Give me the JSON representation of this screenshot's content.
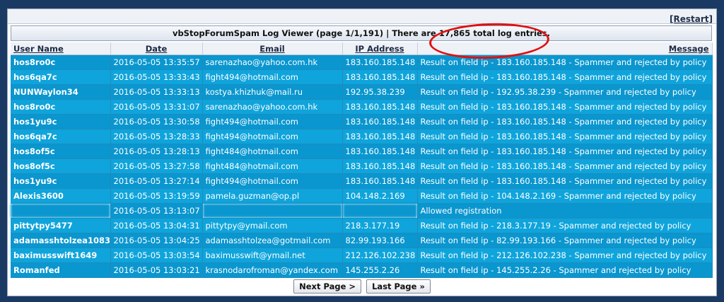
{
  "restart_label": "[Restart]",
  "title": "vbStopForumSpam Log Viewer (page 1/1,191) | There are 17,865 total log entries.",
  "annotation_color": "#e01010",
  "columns": {
    "user": "User Name",
    "date": "Date",
    "email": "Email",
    "ip": "IP Address",
    "message": "Message"
  },
  "rows": [
    {
      "user": "hos8ro0c",
      "date": "2016-05-05 13:35:57",
      "email": "sarenazhao@yahoo.com.hk",
      "ip": "183.160.185.148",
      "message": "Result on field ip - 183.160.185.148 - Spammer and rejected by policy"
    },
    {
      "user": "hos6qa7c",
      "date": "2016-05-05 13:33:43",
      "email": "fight494@hotmail.com",
      "ip": "183.160.185.148",
      "message": "Result on field ip - 183.160.185.148 - Spammer and rejected by policy"
    },
    {
      "user": "NUNWaylon34",
      "date": "2016-05-05 13:33:13",
      "email": "kostya.khizhuk@mail.ru",
      "ip": "192.95.38.239",
      "message": "Result on field ip - 192.95.38.239 - Spammer and rejected by policy"
    },
    {
      "user": "hos8ro0c",
      "date": "2016-05-05 13:31:07",
      "email": "sarenazhao@yahoo.com.hk",
      "ip": "183.160.185.148",
      "message": "Result on field ip - 183.160.185.148 - Spammer and rejected by policy"
    },
    {
      "user": "hos1yu9c",
      "date": "2016-05-05 13:30:58",
      "email": "fight494@hotmail.com",
      "ip": "183.160.185.148",
      "message": "Result on field ip - 183.160.185.148 - Spammer and rejected by policy"
    },
    {
      "user": "hos6qa7c",
      "date": "2016-05-05 13:28:33",
      "email": "fight494@hotmail.com",
      "ip": "183.160.185.148",
      "message": "Result on field ip - 183.160.185.148 - Spammer and rejected by policy"
    },
    {
      "user": "hos8of5c",
      "date": "2016-05-05 13:28:13",
      "email": "fight484@hotmail.com",
      "ip": "183.160.185.148",
      "message": "Result on field ip - 183.160.185.148 - Spammer and rejected by policy"
    },
    {
      "user": "hos8of5c",
      "date": "2016-05-05 13:27:58",
      "email": "fight484@hotmail.com",
      "ip": "183.160.185.148",
      "message": "Result on field ip - 183.160.185.148 - Spammer and rejected by policy"
    },
    {
      "user": "hos1yu9c",
      "date": "2016-05-05 13:27:14",
      "email": "fight494@hotmail.com",
      "ip": "183.160.185.148",
      "message": "Result on field ip - 183.160.185.148 - Spammer and rejected by policy"
    },
    {
      "user": "Alexis3600",
      "date": "2016-05-05 13:19:59",
      "email": "pamela.guzman@op.pl",
      "ip": "104.148.2.169",
      "message": "Result on field ip - 104.148.2.169 - Spammer and rejected by policy"
    },
    {
      "user": "",
      "date": "2016-05-05 13:13:07",
      "email": "",
      "ip": "",
      "message": "Allowed registration"
    },
    {
      "user": "pittytpy5477",
      "date": "2016-05-05 13:04:31",
      "email": "pittytpy@ymail.com",
      "ip": "218.3.177.19",
      "message": "Result on field ip - 218.3.177.19 - Spammer and rejected by policy"
    },
    {
      "user": "adamasshtolzea1083",
      "date": "2016-05-05 13:04:25",
      "email": "adamasshtolzea@gotmail.com",
      "ip": "82.99.193.166",
      "message": "Result on field ip - 82.99.193.166 - Spammer and rejected by policy"
    },
    {
      "user": "baximusswift1649",
      "date": "2016-05-05 13:03:54",
      "email": "baximusswift@ymail.net",
      "ip": "212.126.102.238",
      "message": "Result on field ip - 212.126.102.238 - Spammer and rejected by policy"
    },
    {
      "user": "Romanfed",
      "date": "2016-05-05 13:03:21",
      "email": "krasnodarofroman@yandex.com",
      "ip": "145.255.2.26",
      "message": "Result on field ip - 145.255.2.26 - Spammer and rejected by policy"
    }
  ],
  "pager": {
    "next": "Next Page >",
    "last": "Last Page »"
  }
}
